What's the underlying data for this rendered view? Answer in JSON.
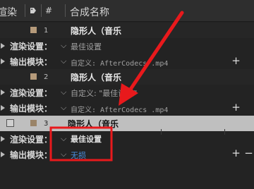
{
  "header": {
    "render_label": "渲染",
    "hash_label": "#",
    "comp_name_label": "合成名称"
  },
  "rows": [
    {
      "num": "1",
      "name": "隐形人（音乐"
    },
    {
      "render_label": "渲染设置：",
      "render_value": "最佳设置"
    },
    {
      "output_label": "输出模块：",
      "output_value": "自定义: AfterCodecs .mp4"
    },
    {
      "num": "2",
      "name": "隐形人（音乐"
    },
    {
      "render_label": "渲染设置：",
      "render_value": "自定义: \"最佳设置\""
    },
    {
      "output_label": "输出模块：",
      "output_value": "自定义: AfterCodecs .mp4"
    },
    {
      "num": "3",
      "name": "隐形人（音乐"
    },
    {
      "render_label": "渲染设置：",
      "render_value": "最佳设置"
    },
    {
      "output_label": "输出模块：",
      "output_value": "无损"
    }
  ],
  "colors": {
    "annotation": "#e8191c",
    "label_swatch": "#b59a7a",
    "link": "#4a90e2"
  },
  "icons": [
    "tag-icon",
    "expand-triangle-icon",
    "dropdown-chevron-icon",
    "add-icon",
    "red-arrow-annotation"
  ]
}
